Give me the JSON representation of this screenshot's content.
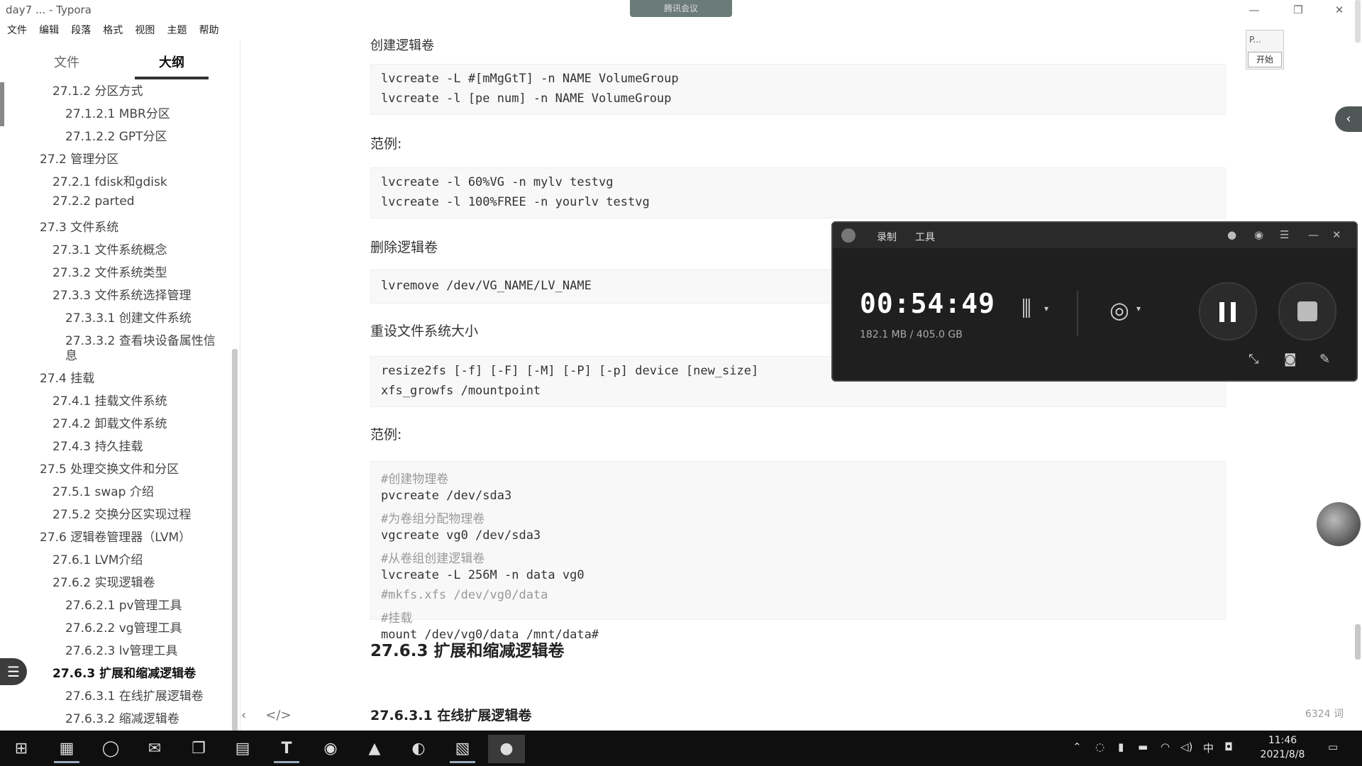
{
  "window": {
    "title": "day7 ... - Typora",
    "controls": [
      "—",
      "❐",
      "✕"
    ],
    "meeting_tab": "腾讯会议"
  },
  "menu": [
    "文件",
    "编辑",
    "段落",
    "格式",
    "视图",
    "主题",
    "帮助"
  ],
  "sidebar": {
    "tabs": [
      "文件",
      "大纲"
    ],
    "active_tab": "大纲",
    "outline": [
      {
        "label": "27.1.2 分区方式",
        "level": 2
      },
      {
        "label": "27.1.2.1 MBR分区",
        "level": 3
      },
      {
        "label": "27.1.2.2 GPT分区",
        "level": 3
      },
      {
        "label": "27.2 管理分区",
        "level": 1
      },
      {
        "label": "27.2.1 fdisk和gdisk",
        "level": 2
      },
      {
        "label": "27.2.2 parted",
        "level": 2
      },
      {
        "label": "27.3 文件系统",
        "level": 1
      },
      {
        "label": "27.3.1 文件系统概念",
        "level": 2
      },
      {
        "label": "27.3.2 文件系统类型",
        "level": 2
      },
      {
        "label": "27.3.3 文件系统选择管理",
        "level": 2
      },
      {
        "label": "27.3.3.1 创建文件系统",
        "level": 3
      },
      {
        "label": "27.3.3.2 查看块设备属性信",
        "level": 3,
        "cont": "息"
      },
      {
        "label": "27.4 挂载",
        "level": 1
      },
      {
        "label": "27.4.1 挂载文件系统",
        "level": 2
      },
      {
        "label": "27.4.2 卸载文件系统",
        "level": 2
      },
      {
        "label": "27.4.3 持久挂载",
        "level": 2
      },
      {
        "label": "27.5 处理交换文件和分区",
        "level": 1
      },
      {
        "label": "27.5.1 swap 介绍",
        "level": 2
      },
      {
        "label": "27.5.2 交换分区实现过程",
        "level": 2
      },
      {
        "label": "27.6 逻辑卷管理器（LVM）",
        "level": 1
      },
      {
        "label": "27.6.1 LVM介绍",
        "level": 2
      },
      {
        "label": "27.6.2 实现逻辑卷",
        "level": 2
      },
      {
        "label": "27.6.2.1 pv管理工具",
        "level": 3
      },
      {
        "label": "27.6.2.2 vg管理工具",
        "level": 3
      },
      {
        "label": "27.6.2.3 lv管理工具",
        "level": 3
      },
      {
        "label": "27.6.3 扩展和缩减逻辑卷",
        "level": 2,
        "active": true
      },
      {
        "label": "27.6.3.1 在线扩展逻辑卷",
        "level": 3
      },
      {
        "label": "27.6.3.2 缩减逻辑卷",
        "level": 3
      }
    ],
    "bottom_icons": [
      "‹",
      "</>"
    ]
  },
  "doc": {
    "heading_cut": "创建逻辑卷",
    "code1": [
      "lvcreate -L #[mMgGtT] -n NAME VolumeGroup",
      "lvcreate -l [pe num] -n NAME VolumeGroup"
    ],
    "para1": "范例:",
    "code2": [
      "lvcreate -l 60%VG -n mylv testvg",
      "lvcreate -l 100%FREE -n yourlv testvg"
    ],
    "para2": "删除逻辑卷",
    "code3": [
      "lvremove /dev/VG_NAME/LV_NAME"
    ],
    "para3": "重设文件系统大小",
    "code4": [
      "resize2fs [-f] [-F] [-M] [-P] [-p] device [new_size]",
      "xfs_growfs /mountpoint"
    ],
    "para4": "范例:",
    "code5": [
      {
        "text": "#创建物理卷",
        "comment": true
      },
      {
        "text": "pvcreate /dev/sda3",
        "comment": false
      },
      {
        "text": "#为卷组分配物理卷",
        "comment": true
      },
      {
        "text": "vgcreate vg0 /dev/sda3",
        "comment": false
      },
      {
        "text": "#从卷组创建逻辑卷",
        "comment": true
      },
      {
        "text": "lvcreate -L 256M -n data vg0",
        "comment": false
      },
      {
        "text": "#mkfs.xfs /dev/vg0/data",
        "comment": true
      },
      {
        "text": "#挂载",
        "comment": true
      },
      {
        "text": "mount /dev/vg0/data /mnt/data#",
        "comment": false
      }
    ],
    "h3": "27.6.3 扩展和缩减逻辑卷",
    "h4": "27.6.3.1 在线扩展逻辑卷",
    "word_count": "6324 词"
  },
  "mini_widget": {
    "label": "P...",
    "button": "开始"
  },
  "recorder": {
    "tabs": [
      "录制",
      "工具"
    ],
    "timer": "00:54:49",
    "storage": "182.1 MB / 405.0 GB",
    "icons": [
      "audio-wave-icon",
      "camera-source-icon",
      "pause-icon",
      "stop-icon",
      "shrink-icon",
      "screenshot-icon",
      "pen-icon"
    ]
  },
  "taskbar": {
    "time": "11:46",
    "date": "2021/8/8",
    "ime": "中",
    "apps": [
      "start-icon",
      "photos-icon",
      "browser-icon",
      "wechat-icon",
      "taskview-icon",
      "explorer-icon",
      "typora-icon",
      "media-icon",
      "gallery-icon",
      "qq-icon",
      "picture-icon",
      "recorder-icon"
    ]
  }
}
